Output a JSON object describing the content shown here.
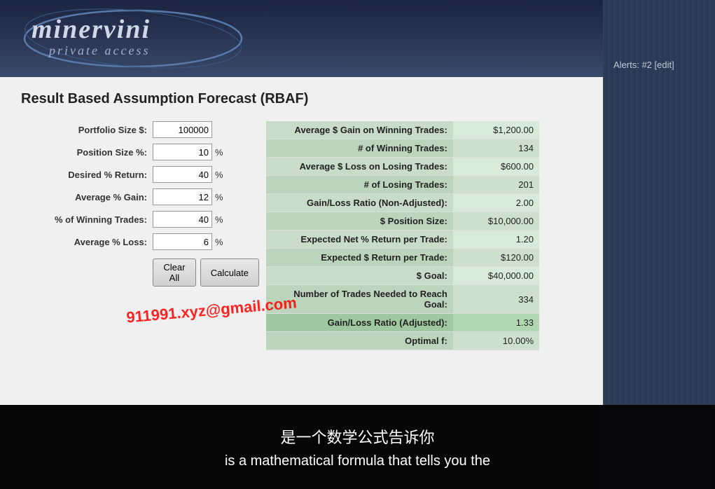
{
  "header": {
    "logo_top": "minervini",
    "logo_bottom": "private access",
    "alerts_text": "Alerts: #2 [edit]"
  },
  "page": {
    "title": "Result Based Assumption Forecast (RBAF)"
  },
  "form": {
    "fields": [
      {
        "label": "Portfolio Size $:",
        "value": "100000",
        "unit": ""
      },
      {
        "label": "Position Size %:",
        "value": "10",
        "unit": "%"
      },
      {
        "label": "Desired % Return:",
        "value": "40",
        "unit": "%"
      },
      {
        "label": "Average % Gain:",
        "value": "12",
        "unit": "%"
      },
      {
        "label": "% of Winning Trades:",
        "value": "40",
        "unit": "%"
      },
      {
        "label": "Average % Loss:",
        "value": "6",
        "unit": "%"
      }
    ],
    "buttons": {
      "clear_all": "Clear All",
      "calculate": "Calculate"
    }
  },
  "results": {
    "rows": [
      {
        "label": "Average $ Gain on Winning Trades:",
        "value": "$1,200.00"
      },
      {
        "label": "# of Winning Trades:",
        "value": "134"
      },
      {
        "label": "Average $ Loss on Losing Trades:",
        "value": "$600.00"
      },
      {
        "label": "# of Losing Trades:",
        "value": "201"
      },
      {
        "label": "Gain/Loss Ratio (Non-Adjusted):",
        "value": "2.00"
      },
      {
        "label": "$ Position Size:",
        "value": "$10,000.00"
      },
      {
        "label": "Expected Net % Return per Trade:",
        "value": "1.20"
      },
      {
        "label": "Expected $ Return per Trade:",
        "value": "$120.00"
      },
      {
        "label": "$ Goal:",
        "value": "$40,000.00"
      },
      {
        "label": "Number of Trades Needed to Reach Goal:",
        "value": "334"
      },
      {
        "label": "Gain/Loss Ratio (Adjusted):",
        "value": "1.33"
      },
      {
        "label": "Optimal f:",
        "value": "10.00%"
      }
    ]
  },
  "watermark": "911991.xyz@gmail.com",
  "subtitles": {
    "chinese": "是一个数学公式告诉你",
    "english": "is a mathematical formula that tells you the"
  }
}
